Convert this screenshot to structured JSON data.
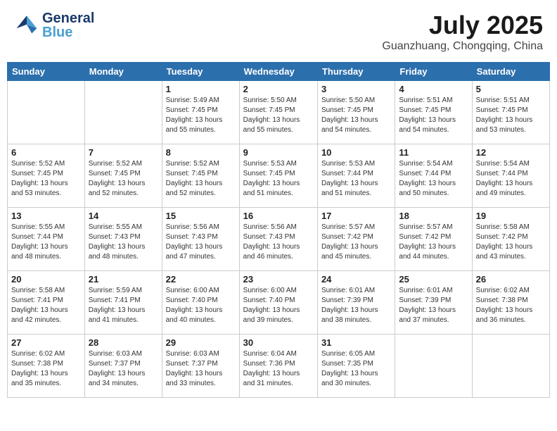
{
  "header": {
    "logo_general": "General",
    "logo_blue": "Blue",
    "month_title": "July 2025",
    "subtitle": "Guanzhuang, Chongqing, China"
  },
  "weekdays": [
    "Sunday",
    "Monday",
    "Tuesday",
    "Wednesday",
    "Thursday",
    "Friday",
    "Saturday"
  ],
  "weeks": [
    [
      {
        "day": "",
        "info": ""
      },
      {
        "day": "",
        "info": ""
      },
      {
        "day": "1",
        "info": "Sunrise: 5:49 AM\nSunset: 7:45 PM\nDaylight: 13 hours\nand 55 minutes."
      },
      {
        "day": "2",
        "info": "Sunrise: 5:50 AM\nSunset: 7:45 PM\nDaylight: 13 hours\nand 55 minutes."
      },
      {
        "day": "3",
        "info": "Sunrise: 5:50 AM\nSunset: 7:45 PM\nDaylight: 13 hours\nand 54 minutes."
      },
      {
        "day": "4",
        "info": "Sunrise: 5:51 AM\nSunset: 7:45 PM\nDaylight: 13 hours\nand 54 minutes."
      },
      {
        "day": "5",
        "info": "Sunrise: 5:51 AM\nSunset: 7:45 PM\nDaylight: 13 hours\nand 53 minutes."
      }
    ],
    [
      {
        "day": "6",
        "info": "Sunrise: 5:52 AM\nSunset: 7:45 PM\nDaylight: 13 hours\nand 53 minutes."
      },
      {
        "day": "7",
        "info": "Sunrise: 5:52 AM\nSunset: 7:45 PM\nDaylight: 13 hours\nand 52 minutes."
      },
      {
        "day": "8",
        "info": "Sunrise: 5:52 AM\nSunset: 7:45 PM\nDaylight: 13 hours\nand 52 minutes."
      },
      {
        "day": "9",
        "info": "Sunrise: 5:53 AM\nSunset: 7:45 PM\nDaylight: 13 hours\nand 51 minutes."
      },
      {
        "day": "10",
        "info": "Sunrise: 5:53 AM\nSunset: 7:44 PM\nDaylight: 13 hours\nand 51 minutes."
      },
      {
        "day": "11",
        "info": "Sunrise: 5:54 AM\nSunset: 7:44 PM\nDaylight: 13 hours\nand 50 minutes."
      },
      {
        "day": "12",
        "info": "Sunrise: 5:54 AM\nSunset: 7:44 PM\nDaylight: 13 hours\nand 49 minutes."
      }
    ],
    [
      {
        "day": "13",
        "info": "Sunrise: 5:55 AM\nSunset: 7:44 PM\nDaylight: 13 hours\nand 48 minutes."
      },
      {
        "day": "14",
        "info": "Sunrise: 5:55 AM\nSunset: 7:43 PM\nDaylight: 13 hours\nand 48 minutes."
      },
      {
        "day": "15",
        "info": "Sunrise: 5:56 AM\nSunset: 7:43 PM\nDaylight: 13 hours\nand 47 minutes."
      },
      {
        "day": "16",
        "info": "Sunrise: 5:56 AM\nSunset: 7:43 PM\nDaylight: 13 hours\nand 46 minutes."
      },
      {
        "day": "17",
        "info": "Sunrise: 5:57 AM\nSunset: 7:42 PM\nDaylight: 13 hours\nand 45 minutes."
      },
      {
        "day": "18",
        "info": "Sunrise: 5:57 AM\nSunset: 7:42 PM\nDaylight: 13 hours\nand 44 minutes."
      },
      {
        "day": "19",
        "info": "Sunrise: 5:58 AM\nSunset: 7:42 PM\nDaylight: 13 hours\nand 43 minutes."
      }
    ],
    [
      {
        "day": "20",
        "info": "Sunrise: 5:58 AM\nSunset: 7:41 PM\nDaylight: 13 hours\nand 42 minutes."
      },
      {
        "day": "21",
        "info": "Sunrise: 5:59 AM\nSunset: 7:41 PM\nDaylight: 13 hours\nand 41 minutes."
      },
      {
        "day": "22",
        "info": "Sunrise: 6:00 AM\nSunset: 7:40 PM\nDaylight: 13 hours\nand 40 minutes."
      },
      {
        "day": "23",
        "info": "Sunrise: 6:00 AM\nSunset: 7:40 PM\nDaylight: 13 hours\nand 39 minutes."
      },
      {
        "day": "24",
        "info": "Sunrise: 6:01 AM\nSunset: 7:39 PM\nDaylight: 13 hours\nand 38 minutes."
      },
      {
        "day": "25",
        "info": "Sunrise: 6:01 AM\nSunset: 7:39 PM\nDaylight: 13 hours\nand 37 minutes."
      },
      {
        "day": "26",
        "info": "Sunrise: 6:02 AM\nSunset: 7:38 PM\nDaylight: 13 hours\nand 36 minutes."
      }
    ],
    [
      {
        "day": "27",
        "info": "Sunrise: 6:02 AM\nSunset: 7:38 PM\nDaylight: 13 hours\nand 35 minutes."
      },
      {
        "day": "28",
        "info": "Sunrise: 6:03 AM\nSunset: 7:37 PM\nDaylight: 13 hours\nand 34 minutes."
      },
      {
        "day": "29",
        "info": "Sunrise: 6:03 AM\nSunset: 7:37 PM\nDaylight: 13 hours\nand 33 minutes."
      },
      {
        "day": "30",
        "info": "Sunrise: 6:04 AM\nSunset: 7:36 PM\nDaylight: 13 hours\nand 31 minutes."
      },
      {
        "day": "31",
        "info": "Sunrise: 6:05 AM\nSunset: 7:35 PM\nDaylight: 13 hours\nand 30 minutes."
      },
      {
        "day": "",
        "info": ""
      },
      {
        "day": "",
        "info": ""
      }
    ]
  ]
}
